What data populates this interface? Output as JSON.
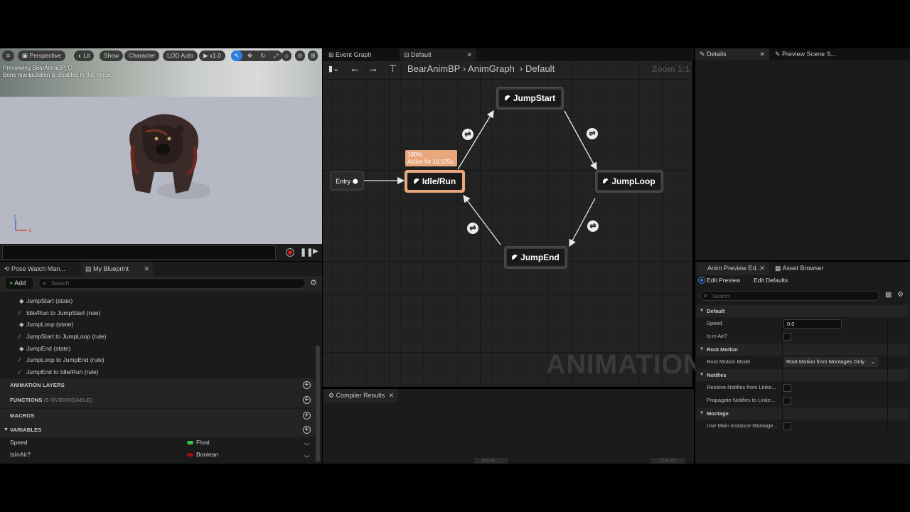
{
  "viewport": {
    "buttons": [
      "Perspective",
      "Lit",
      "Show",
      "Character",
      "LOD Auto",
      "x1.0"
    ],
    "message_line1": "Previewing BearAnimBP_C.",
    "message_line2": "Bone manipulation is disabled in this mode.",
    "axis_z": "Z",
    "axis_x": "X"
  },
  "left_tabs": {
    "pose_watch": "Pose Watch Man...",
    "my_blueprint": "My Blueprint"
  },
  "my_blueprint": {
    "add_label": "Add",
    "search_placeholder": "Search",
    "tree_items": [
      {
        "icon": "state",
        "label": "JumpStart (state)"
      },
      {
        "icon": "rule",
        "label": "Idle/Run to JumpStart (rule)"
      },
      {
        "icon": "state",
        "label": "JumpLoop (state)"
      },
      {
        "icon": "rule",
        "label": "JumpStart to JumpLoop (rule)"
      },
      {
        "icon": "state",
        "label": "JumpEnd (state)"
      },
      {
        "icon": "rule",
        "label": "JumpLoop to JumpEnd (rule)"
      },
      {
        "icon": "rule",
        "label": "JumpEnd to Idle/Run (rule)"
      }
    ],
    "sections": {
      "animation_layers": "ANIMATION LAYERS",
      "functions": "FUNCTIONS",
      "functions_note": "(5 OVERRIDABLE)",
      "macros": "MACROS",
      "variables": "VARIABLES"
    },
    "variables": [
      {
        "name": "Speed",
        "type": "Float",
        "color": "#3fbf3f"
      },
      {
        "name": "IsInAir?",
        "type": "Boolean",
        "color": "#a01010"
      }
    ]
  },
  "graph_tabs": {
    "event_graph": "Event Graph",
    "default": "Default"
  },
  "breadcrumb": {
    "asset": "BearAnimBP",
    "graph": "AnimGraph",
    "state_machine": "Default",
    "zoom": "Zoom 1:1"
  },
  "nodes": {
    "entry": "Entry",
    "idle_run": "Idle/Run",
    "jump_start": "JumpStart",
    "jump_loop": "JumpLoop",
    "jump_end": "JumpEnd"
  },
  "active_info": {
    "percent": "100%",
    "active_for": "Active for 10.125s"
  },
  "watermark": "ANIMATION",
  "compiler": {
    "tab": "Compiler Results",
    "page_button": "PAGE",
    "clear_button": "CLEAR"
  },
  "right_tabs": {
    "details": "Details",
    "preview_scene": "Preview Scene S...",
    "anim_preview": "Anim Preview Ed...",
    "asset_browser": "Asset Browser"
  },
  "anim_preview": {
    "edit_preview": "Edit Preview",
    "edit_defaults": "Edit Defaults",
    "search_placeholder": "Search",
    "sections": {
      "default": "Default",
      "root_motion": "Root Motion",
      "notifies": "Notifies",
      "montage": "Montage"
    },
    "speed_label": "Speed",
    "speed_value": "0.0",
    "is_in_air_label": "Is in Air?",
    "root_motion_mode_label": "Root Motion Mode",
    "root_motion_mode_value": "Root Motion from Montages Only",
    "receive_notifies_label": "Receive Notifies from Linke...",
    "propagate_notifies_label": "Propagate Notifies to Linke...",
    "use_main_instance_label": "Use Main Instance Montage..."
  },
  "colors": {
    "active_node": "#e8a77c",
    "accent_blue": "#2f7fe0",
    "record_red": "#d42020"
  }
}
